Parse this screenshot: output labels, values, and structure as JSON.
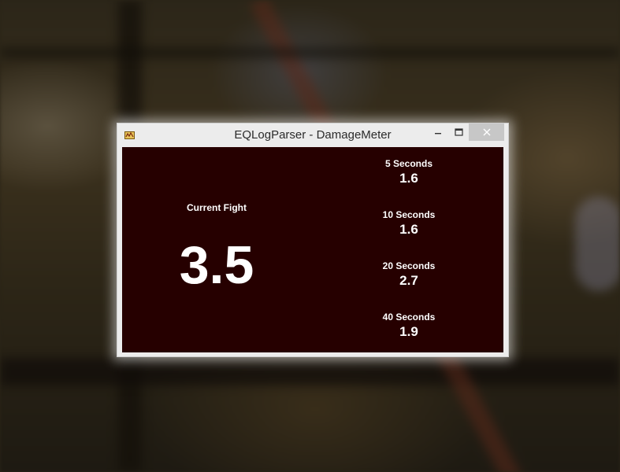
{
  "window": {
    "title": "EQLogParser - DamageMeter",
    "icon": "app-icon",
    "controls": {
      "minimize": "–",
      "maximize": "□",
      "close": "✕"
    }
  },
  "meter": {
    "current_fight_label": "Current Fight",
    "current_fight_value": "3.5",
    "intervals": [
      {
        "label": "5 Seconds",
        "value": "1.6"
      },
      {
        "label": "10 Seconds",
        "value": "1.6"
      },
      {
        "label": "20 Seconds",
        "value": "2.7"
      },
      {
        "label": "40 Seconds",
        "value": "1.9"
      }
    ]
  },
  "colors": {
    "meter_background": "#260000",
    "text": "#ffffff",
    "window_frame": "#ececec",
    "close_button": "#c7c7c7"
  }
}
